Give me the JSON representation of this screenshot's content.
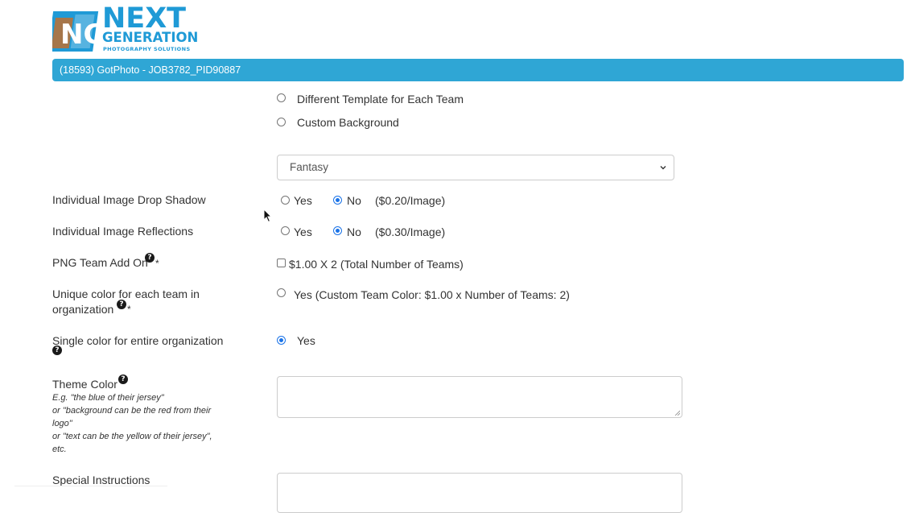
{
  "logo": {
    "line1": "NEXT",
    "line2": "GENERATION",
    "line3": "PHOTOGRAPHY SOLUTIONS"
  },
  "job_title": "(18593) GotPhoto - JOB3782_PID90887",
  "template_options": [
    {
      "label": "Different Template for Each Team",
      "checked": false
    },
    {
      "label": "Custom Background",
      "checked": false
    }
  ],
  "background_select": {
    "value": "Fantasy"
  },
  "drop_shadow": {
    "label": "Individual Image Drop Shadow",
    "yes": "Yes",
    "no": "No",
    "price": "($0.20/Image)",
    "selected": "No"
  },
  "reflections": {
    "label": "Individual Image Reflections",
    "yes": "Yes",
    "no": "No",
    "price": "($0.30/Image)",
    "selected": "No"
  },
  "png_team": {
    "label": "PNG Team Add On",
    "required": "*",
    "option": "$1.00 X 2 (Total Number of Teams)",
    "checked": false
  },
  "unique_color": {
    "label_line1": "Unique color for each team in",
    "label_line2": "organization",
    "required": "*",
    "option": "Yes (Custom Team Color: $1.00 x Number of Teams: 2)",
    "checked": false
  },
  "single_color": {
    "label": "Single color for entire organization",
    "option": "Yes",
    "checked": true
  },
  "theme_color": {
    "label": "Theme Color",
    "hints": [
      "E.g. \"the blue of their jersey\"",
      "or \"background can be the red from their",
      "logo\"",
      "or \"text can be the yellow of their jersey\",",
      "etc."
    ],
    "value": ""
  },
  "special_instructions": {
    "label": "Special Instructions",
    "value": ""
  },
  "colors": {
    "accent": "#2fa6d5",
    "radio_checked": "#1a73e8",
    "logo_blue": "#1f9ad6"
  }
}
